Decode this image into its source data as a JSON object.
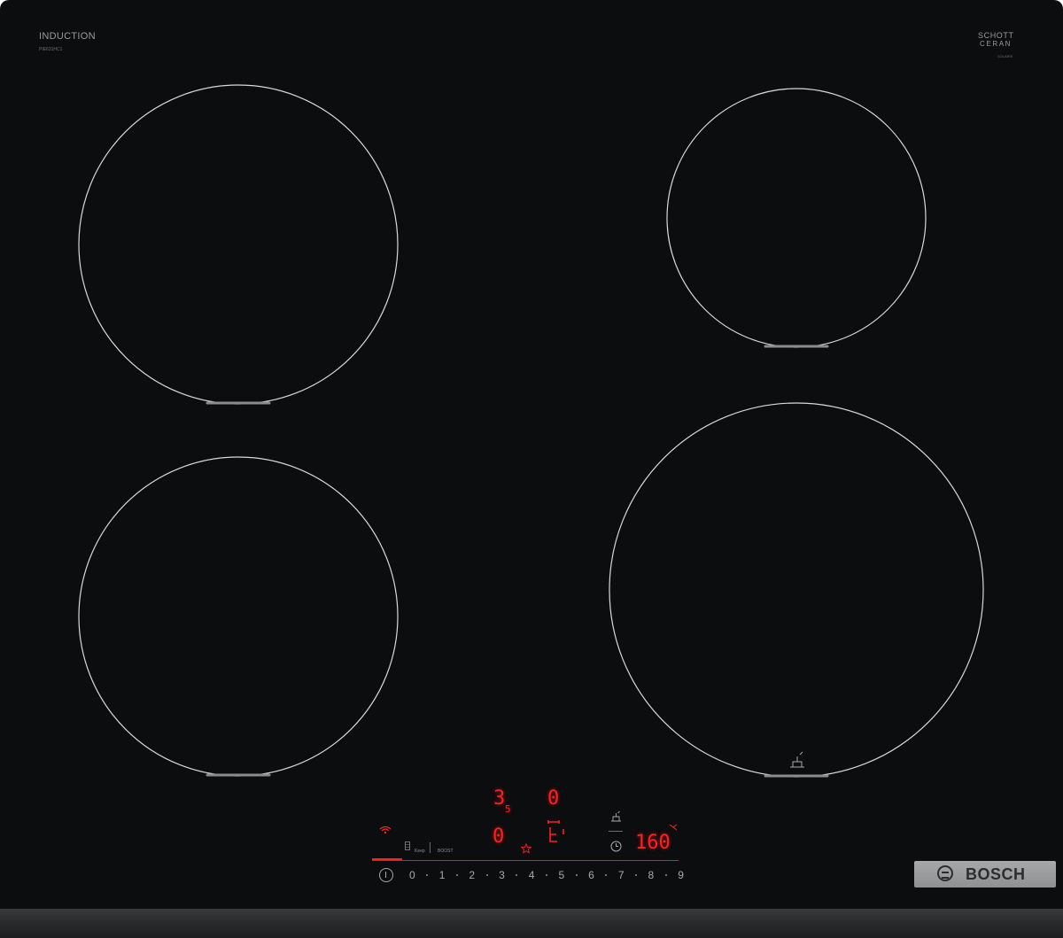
{
  "header": {
    "label_top_left": "INDUCTION",
    "model_number": "PIE631HC1",
    "brand_top_right_line1": "SCHOTT",
    "brand_top_right_line2": "CERAN",
    "brand_top_right_sub": "SOLARIS"
  },
  "displays": {
    "zone_rear_left": "3",
    "zone_rear_left_sub": "5",
    "zone_rear_right": "0",
    "zone_front_left": "0",
    "zone_front_right_timer": "160"
  },
  "controls": {
    "keep_warm_label": "Keep",
    "boost_label": "BOOST",
    "power_scale": [
      "0",
      "1",
      "2",
      "3",
      "4",
      "5",
      "6",
      "7",
      "8",
      "9"
    ]
  },
  "logo": {
    "text": "BOSCH"
  },
  "colors": {
    "glass": "#0c0d0e",
    "display_red": "#ff1f1f",
    "zone_outline": "#d9d9d9",
    "logo_plate": "#9a9b9d"
  }
}
